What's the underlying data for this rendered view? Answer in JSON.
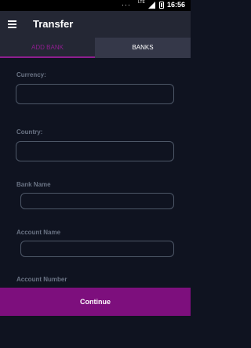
{
  "status_bar": {
    "dots": "···",
    "network": "LTE",
    "time": "16:56"
  },
  "app_bar": {
    "title": "Transfer"
  },
  "tabs": [
    {
      "label": "ADD BANK"
    },
    {
      "label": "BANKS"
    }
  ],
  "form": {
    "currency_label": "Currency:",
    "currency_value": "",
    "country_label": "Country:",
    "country_value": "",
    "bank_name_label": "Bank Name",
    "bank_name_value": "",
    "account_name_label": "Account Name",
    "account_name_value": "",
    "account_number_label": "Account Number"
  },
  "continue_label": "Continue",
  "colors": {
    "background": "#0f1320",
    "toolbar": "#242734",
    "accent": "#8e1e8f",
    "button": "#7d0f7d"
  }
}
